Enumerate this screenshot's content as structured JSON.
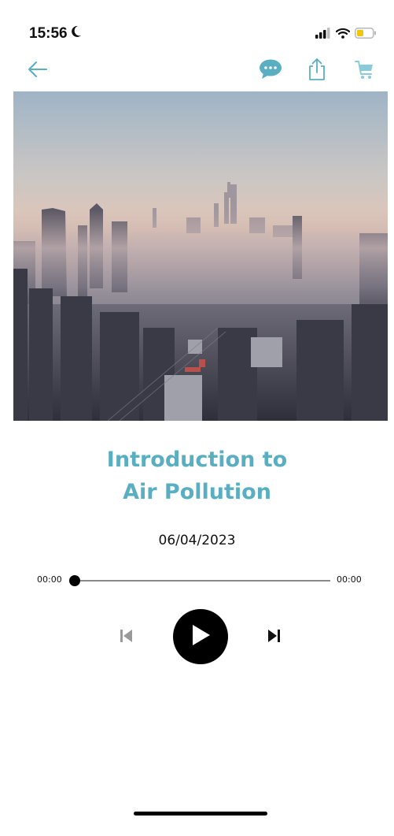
{
  "status": {
    "time": "15:56"
  },
  "player": {
    "title_line1": "Introduction to",
    "title_line2": "Air Pollution",
    "date": "06/04/2023",
    "current_time": "00:00",
    "total_time": "00:00",
    "progress": 0
  },
  "colors": {
    "accent": "#5aaec1",
    "accent_light": "#8ccad8",
    "text": "#111111"
  },
  "icons": {
    "back": "arrow-left-icon",
    "comments": "chat-bubble-icon",
    "share": "share-icon",
    "cart": "cart-icon",
    "previous": "skip-previous-icon",
    "play": "play-icon",
    "next": "skip-next-icon"
  }
}
